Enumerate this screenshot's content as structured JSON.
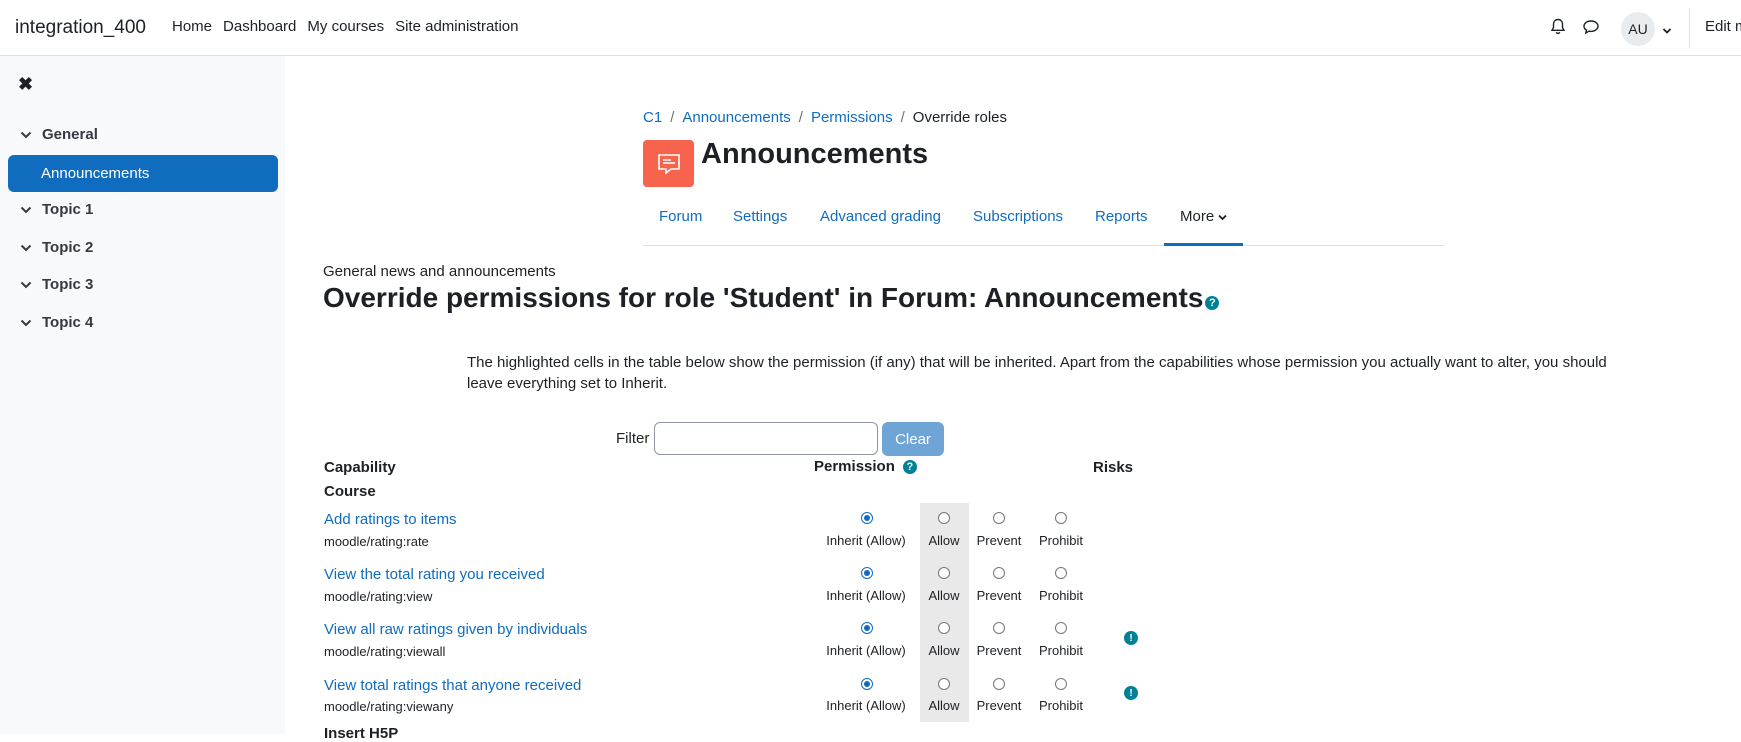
{
  "site": {
    "name": "integration_400"
  },
  "nav": {
    "links": [
      "Home",
      "Dashboard",
      "My courses",
      "Site administration"
    ],
    "avatar_initials": "AU",
    "edit_mode_label": "Edit m"
  },
  "drawer": {
    "sections": [
      {
        "label": "General"
      },
      {
        "label": "Topic 1"
      },
      {
        "label": "Topic 2"
      },
      {
        "label": "Topic 3"
      },
      {
        "label": "Topic 4"
      }
    ],
    "active_item": "Announcements"
  },
  "breadcrumb": {
    "items": [
      "C1",
      "Announcements",
      "Permissions"
    ],
    "current": "Override roles"
  },
  "page": {
    "title": "Announcements",
    "icon": "forum-icon"
  },
  "tabs": [
    "Forum",
    "Settings",
    "Advanced grading",
    "Subscriptions",
    "Reports",
    "More"
  ],
  "main": {
    "subtitle": "General news and announcements",
    "heading": "Override permissions for role 'Student' in Forum: Announcements",
    "intro": "The highlighted cells in the table below show the permission (if any) that will be inherited. Apart from the capabilities whose permission you actually want to alter, you should leave everything set to Inherit.",
    "filter_label": "Filter",
    "filter_value": "",
    "clear_label": "Clear"
  },
  "table": {
    "headers": {
      "capability": "Capability",
      "permission": "Permission",
      "risks": "Risks"
    },
    "group": "Course",
    "options": [
      "Inherit (Allow)",
      "Allow",
      "Prevent",
      "Prohibit"
    ],
    "rows": [
      {
        "name": "Add ratings to items",
        "code": "moodle/rating:rate",
        "selected": "Inherit (Allow)",
        "risk": false
      },
      {
        "name": "View the total rating you received",
        "code": "moodle/rating:view",
        "selected": "Inherit (Allow)",
        "risk": false
      },
      {
        "name": "View all raw ratings given by individuals",
        "code": "moodle/rating:viewall",
        "selected": "Inherit (Allow)",
        "risk": true
      },
      {
        "name": "View total ratings that anyone received",
        "code": "moodle/rating:viewany",
        "selected": "Inherit (Allow)",
        "risk": true
      }
    ],
    "next_group": "Insert H5P"
  },
  "colors": {
    "primary": "#0f6cbf",
    "forum_icon_bg": "#f7634d",
    "risk_icon": "#008196",
    "highlight_cell": "#e9e9e9"
  }
}
